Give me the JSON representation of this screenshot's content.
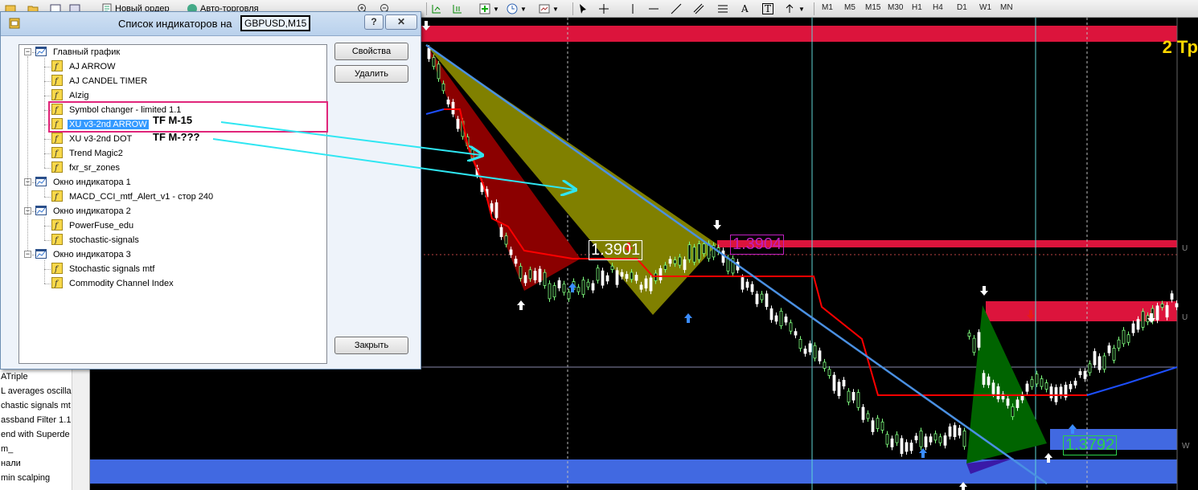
{
  "toolbar": {
    "new_order": "Новый ордер",
    "auto_trading": "Авто-торговля",
    "timeframes": [
      "M1",
      "M5",
      "M15",
      "M30",
      "H1",
      "H4",
      "D1",
      "W1",
      "MN"
    ]
  },
  "navigator": {
    "items": [
      "ATriple",
      "L averages oscilla",
      "chastic signals mt",
      "assband Filter 1.1",
      "end with Superde",
      "m_",
      "нали",
      "min scalping"
    ]
  },
  "dialog": {
    "title": "Список индикаторов на",
    "symbol": "GBPUSD,M15",
    "help": "?",
    "close": "✕",
    "buttons": {
      "properties": "Свойства",
      "delete": "Удалить",
      "close": "Закрыть"
    },
    "tree": [
      {
        "label": "Главный график",
        "type": "window"
      },
      {
        "label": "AJ ARROW",
        "type": "indicator"
      },
      {
        "label": "AJ CANDEL TIMER",
        "type": "indicator"
      },
      {
        "label": "AIzig",
        "type": "indicator"
      },
      {
        "label": "Symbol changer - limited 1.1",
        "type": "indicator"
      },
      {
        "label": "XU v3-2nd ARROW",
        "type": "indicator",
        "selected": true
      },
      {
        "label": "XU v3-2nd DOT",
        "type": "indicator"
      },
      {
        "label": "Trend Magic2",
        "type": "indicator"
      },
      {
        "label": "fxr_sr_zones",
        "type": "indicator"
      },
      {
        "label": "Окно индикатора 1",
        "type": "window"
      },
      {
        "label": "MACD_CCI_mtf_Alert_v1 - стор 240",
        "type": "indicator"
      },
      {
        "label": "Окно индикатора 2",
        "type": "window"
      },
      {
        "label": "PowerFuse_edu",
        "type": "indicator"
      },
      {
        "label": "stochastic-signals",
        "type": "indicator"
      },
      {
        "label": "Окно индикатора 3",
        "type": "window"
      },
      {
        "label": "Stochastic signals mtf",
        "type": "indicator"
      },
      {
        "label": "Commodity Channel Index",
        "type": "indicator"
      }
    ]
  },
  "annotations": {
    "tf1": "TF M-15",
    "tf2": "TF M-???"
  },
  "chart": {
    "corner_label": "2 Тр",
    "price_labels": [
      "1.3901",
      "1.3904",
      "1.3792"
    ],
    "axis_labels": [
      "U",
      "U",
      "W"
    ],
    "colors": {
      "zone_red": "#dc143c",
      "zone_blue": "#4169e1",
      "trendline": "#4a90e2",
      "olive": "#808000",
      "darkred": "#8b0000",
      "green": "#006400",
      "signal_line": "#ff0000"
    }
  }
}
